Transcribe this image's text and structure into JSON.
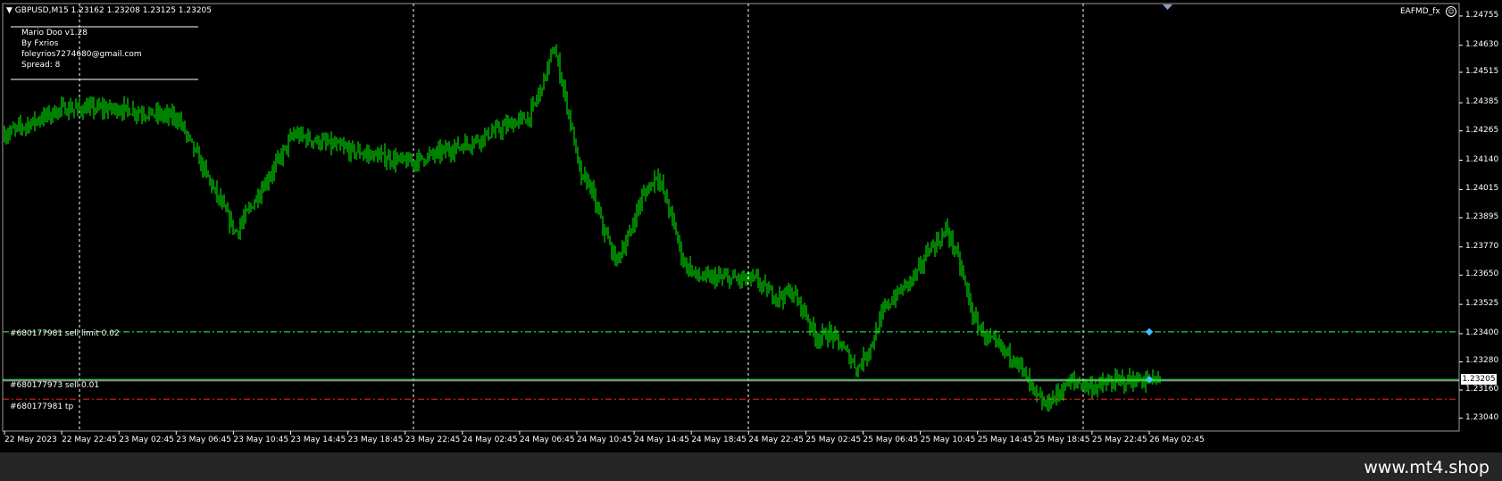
{
  "chart": {
    "symbol_line": "GBPUSD,M15  1.23162 1.23208 1.23125 1.23205",
    "ea_label": "EAFMD_fx",
    "ea_icon": "smiley-icon",
    "current_price": "1.23205"
  },
  "info_panel": {
    "line1": "Mario Doo v1.28",
    "line2": "By Fxrios",
    "line3": "foleyrios7274680@gmail.com",
    "line4": "Spread: 8"
  },
  "orders": {
    "sell_limit": "#680177981 sell limit 0.02",
    "sell": "#680177973 sell 0.01",
    "tp": "#680177981 tp"
  },
  "price_axis": [
    "1.24755",
    "1.24630",
    "1.24515",
    "1.24385",
    "1.24265",
    "1.24140",
    "1.24015",
    "1.23895",
    "1.23770",
    "1.23650",
    "1.23525",
    "1.23400",
    "1.23280",
    "1.23160",
    "1.23040"
  ],
  "time_axis": [
    "22 May 2023",
    "22 May 22:45",
    "23 May 02:45",
    "23 May 06:45",
    "23 May 10:45",
    "23 May 14:45",
    "23 May 18:45",
    "23 May 22:45",
    "24 May 02:45",
    "24 May 06:45",
    "24 May 10:45",
    "24 May 14:45",
    "24 May 18:45",
    "24 May 22:45",
    "25 May 02:45",
    "25 May 06:45",
    "25 May 10:45",
    "25 May 14:45",
    "25 May 18:45",
    "25 May 22:45",
    "26 May 02:45"
  ],
  "colors": {
    "background": "#000000",
    "candle": "#00ff00",
    "grid": "#ffffff",
    "sell_line": "#33ff66",
    "tp_line": "#ff2020",
    "marker": "#40c0ff"
  },
  "chart_data": {
    "type": "line",
    "x": [
      "22 May 2023",
      "22 May 22:45",
      "23 May 02:45",
      "23 May 06:45",
      "23 May 10:45",
      "23 May 14:45",
      "23 May 18:45",
      "23 May 22:45",
      "24 May 02:45",
      "24 May 06:45",
      "24 May 10:45",
      "24 May 14:45",
      "24 May 18:45",
      "24 May 22:45",
      "25 May 02:45",
      "25 May 06:45",
      "25 May 10:45",
      "25 May 14:45",
      "25 May 18:45",
      "25 May 22:45",
      "26 May 02:45"
    ],
    "values": [
      1.2425,
      1.2436,
      1.2436,
      1.2432,
      1.2383,
      1.2425,
      1.2418,
      1.2413,
      1.2421,
      1.2432,
      1.2406,
      1.239,
      1.2364,
      1.2363,
      1.2338,
      1.2345,
      1.2372,
      1.2338,
      1.232,
      1.232,
      1.232
    ],
    "ylim": [
      1.2299,
      1.248
    ]
  },
  "watermark": "www.mt4.shop"
}
